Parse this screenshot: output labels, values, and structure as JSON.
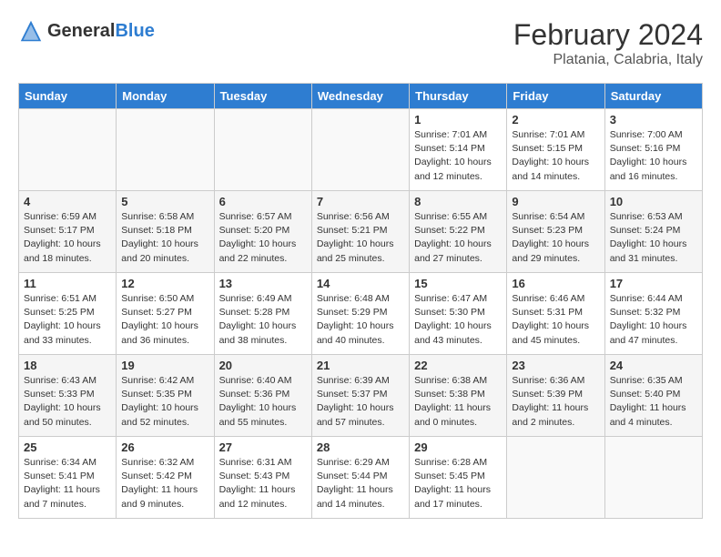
{
  "header": {
    "logo_general": "General",
    "logo_blue": "Blue",
    "month_year": "February 2024",
    "location": "Platania, Calabria, Italy"
  },
  "days_of_week": [
    "Sunday",
    "Monday",
    "Tuesday",
    "Wednesday",
    "Thursday",
    "Friday",
    "Saturday"
  ],
  "weeks": [
    [
      {
        "day": "",
        "info": ""
      },
      {
        "day": "",
        "info": ""
      },
      {
        "day": "",
        "info": ""
      },
      {
        "day": "",
        "info": ""
      },
      {
        "day": "1",
        "info": "Sunrise: 7:01 AM\nSunset: 5:14 PM\nDaylight: 10 hours\nand 12 minutes."
      },
      {
        "day": "2",
        "info": "Sunrise: 7:01 AM\nSunset: 5:15 PM\nDaylight: 10 hours\nand 14 minutes."
      },
      {
        "day": "3",
        "info": "Sunrise: 7:00 AM\nSunset: 5:16 PM\nDaylight: 10 hours\nand 16 minutes."
      }
    ],
    [
      {
        "day": "4",
        "info": "Sunrise: 6:59 AM\nSunset: 5:17 PM\nDaylight: 10 hours\nand 18 minutes."
      },
      {
        "day": "5",
        "info": "Sunrise: 6:58 AM\nSunset: 5:18 PM\nDaylight: 10 hours\nand 20 minutes."
      },
      {
        "day": "6",
        "info": "Sunrise: 6:57 AM\nSunset: 5:20 PM\nDaylight: 10 hours\nand 22 minutes."
      },
      {
        "day": "7",
        "info": "Sunrise: 6:56 AM\nSunset: 5:21 PM\nDaylight: 10 hours\nand 25 minutes."
      },
      {
        "day": "8",
        "info": "Sunrise: 6:55 AM\nSunset: 5:22 PM\nDaylight: 10 hours\nand 27 minutes."
      },
      {
        "day": "9",
        "info": "Sunrise: 6:54 AM\nSunset: 5:23 PM\nDaylight: 10 hours\nand 29 minutes."
      },
      {
        "day": "10",
        "info": "Sunrise: 6:53 AM\nSunset: 5:24 PM\nDaylight: 10 hours\nand 31 minutes."
      }
    ],
    [
      {
        "day": "11",
        "info": "Sunrise: 6:51 AM\nSunset: 5:25 PM\nDaylight: 10 hours\nand 33 minutes."
      },
      {
        "day": "12",
        "info": "Sunrise: 6:50 AM\nSunset: 5:27 PM\nDaylight: 10 hours\nand 36 minutes."
      },
      {
        "day": "13",
        "info": "Sunrise: 6:49 AM\nSunset: 5:28 PM\nDaylight: 10 hours\nand 38 minutes."
      },
      {
        "day": "14",
        "info": "Sunrise: 6:48 AM\nSunset: 5:29 PM\nDaylight: 10 hours\nand 40 minutes."
      },
      {
        "day": "15",
        "info": "Sunrise: 6:47 AM\nSunset: 5:30 PM\nDaylight: 10 hours\nand 43 minutes."
      },
      {
        "day": "16",
        "info": "Sunrise: 6:46 AM\nSunset: 5:31 PM\nDaylight: 10 hours\nand 45 minutes."
      },
      {
        "day": "17",
        "info": "Sunrise: 6:44 AM\nSunset: 5:32 PM\nDaylight: 10 hours\nand 47 minutes."
      }
    ],
    [
      {
        "day": "18",
        "info": "Sunrise: 6:43 AM\nSunset: 5:33 PM\nDaylight: 10 hours\nand 50 minutes."
      },
      {
        "day": "19",
        "info": "Sunrise: 6:42 AM\nSunset: 5:35 PM\nDaylight: 10 hours\nand 52 minutes."
      },
      {
        "day": "20",
        "info": "Sunrise: 6:40 AM\nSunset: 5:36 PM\nDaylight: 10 hours\nand 55 minutes."
      },
      {
        "day": "21",
        "info": "Sunrise: 6:39 AM\nSunset: 5:37 PM\nDaylight: 10 hours\nand 57 minutes."
      },
      {
        "day": "22",
        "info": "Sunrise: 6:38 AM\nSunset: 5:38 PM\nDaylight: 11 hours\nand 0 minutes."
      },
      {
        "day": "23",
        "info": "Sunrise: 6:36 AM\nSunset: 5:39 PM\nDaylight: 11 hours\nand 2 minutes."
      },
      {
        "day": "24",
        "info": "Sunrise: 6:35 AM\nSunset: 5:40 PM\nDaylight: 11 hours\nand 4 minutes."
      }
    ],
    [
      {
        "day": "25",
        "info": "Sunrise: 6:34 AM\nSunset: 5:41 PM\nDaylight: 11 hours\nand 7 minutes."
      },
      {
        "day": "26",
        "info": "Sunrise: 6:32 AM\nSunset: 5:42 PM\nDaylight: 11 hours\nand 9 minutes."
      },
      {
        "day": "27",
        "info": "Sunrise: 6:31 AM\nSunset: 5:43 PM\nDaylight: 11 hours\nand 12 minutes."
      },
      {
        "day": "28",
        "info": "Sunrise: 6:29 AM\nSunset: 5:44 PM\nDaylight: 11 hours\nand 14 minutes."
      },
      {
        "day": "29",
        "info": "Sunrise: 6:28 AM\nSunset: 5:45 PM\nDaylight: 11 hours\nand 17 minutes."
      },
      {
        "day": "",
        "info": ""
      },
      {
        "day": "",
        "info": ""
      }
    ]
  ]
}
